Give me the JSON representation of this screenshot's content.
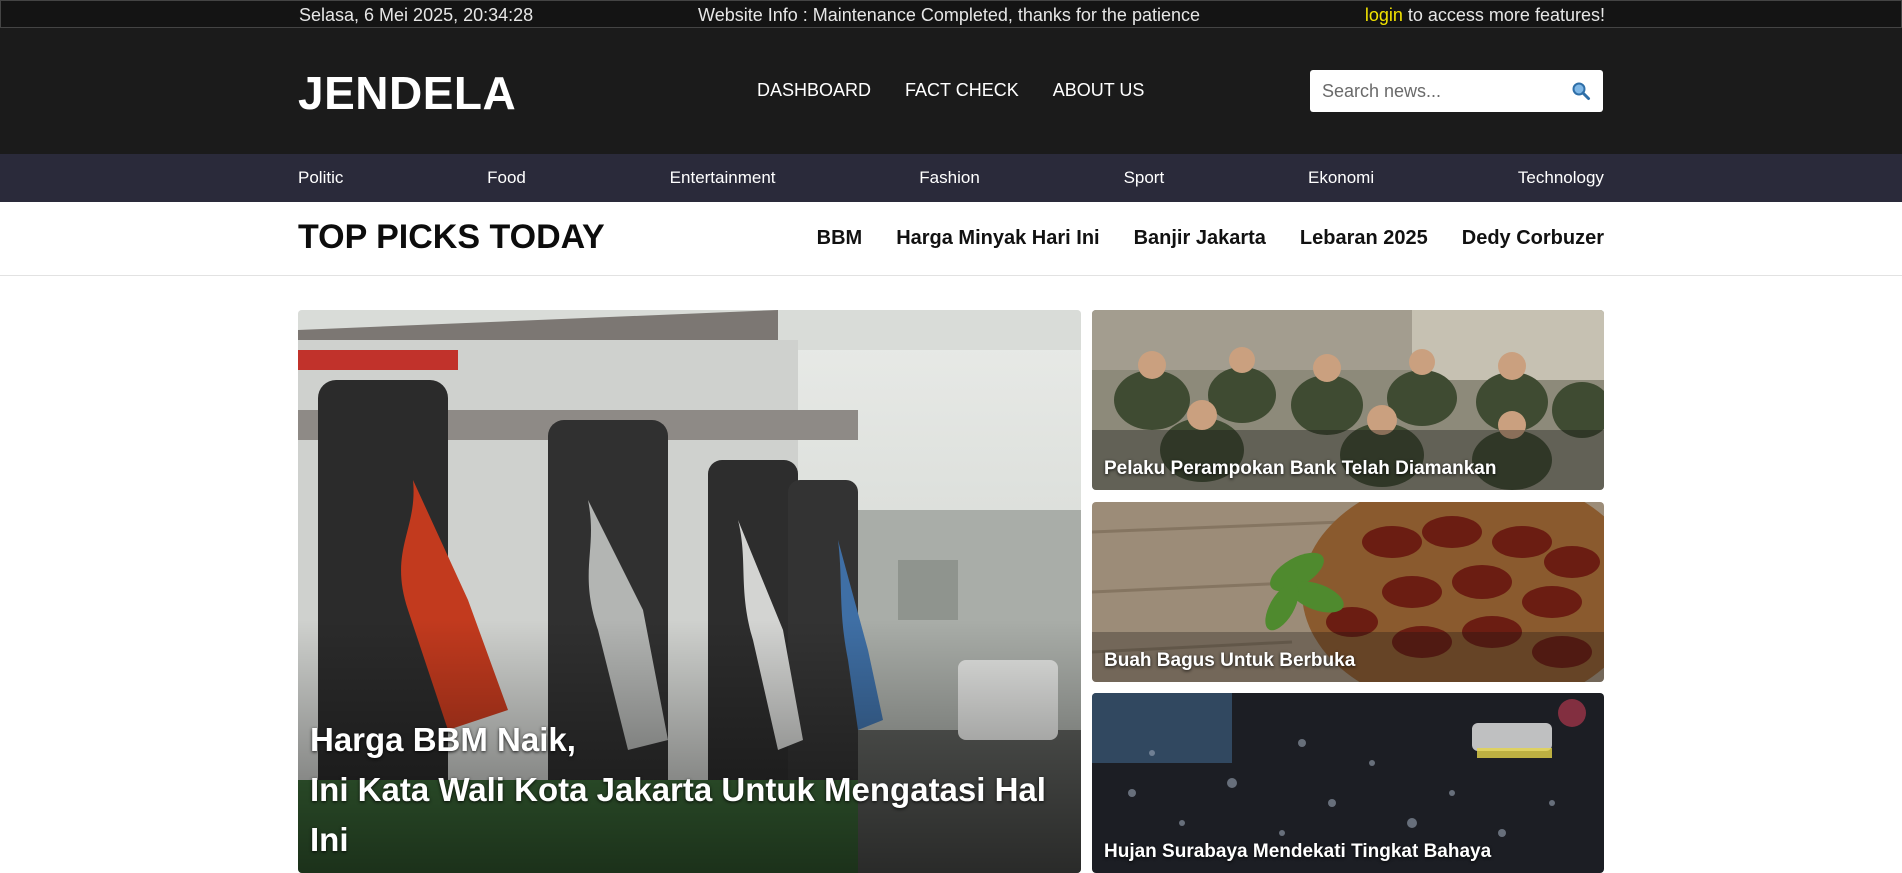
{
  "topbar": {
    "datetime": "Selasa, 6 Mei 2025, 20:34:28",
    "info": "Website Info : Maintenance Completed, thanks for the patience",
    "login_link": "login",
    "login_suffix": " to access more features!"
  },
  "header": {
    "logo": "JENDELA",
    "nav": [
      "DASHBOARD",
      "FACT CHECK",
      "ABOUT US"
    ],
    "search_placeholder": "Search news...",
    "search_icon": "magnifier-icon"
  },
  "categories": [
    "Politic",
    "Food",
    "Entertainment",
    "Fashion",
    "Sport",
    "Ekonomi",
    "Technology"
  ],
  "top_picks": {
    "title": "TOP PICKS TODAY",
    "tags": [
      "BBM",
      "Harga Minyak Hari Ini",
      "Banjir Jakarta",
      "Lebaran 2025",
      "Dedy Corbuzer"
    ]
  },
  "articles": {
    "main": {
      "line1": "Harga BBM Naik,",
      "line2": "Ini Kata Wali Kota Jakarta Untuk Mengatasi Hal Ini",
      "image": "fuel-pump-photo"
    },
    "side": [
      {
        "title": "Pelaku Perampokan Bank Telah Diamankan",
        "image": "military-meeting-photo"
      },
      {
        "title": "Buah Bagus Untuk Berbuka",
        "image": "dates-fruit-photo"
      },
      {
        "title": "Hujan Surabaya Mendekati Tingkat Bahaya",
        "image": "rainy-window-photo"
      }
    ]
  },
  "colors": {
    "topbar_bg": "#141414",
    "header_bg": "#1b1b1b",
    "category_bg": "#2a2a3a",
    "login_accent": "#f1e200"
  }
}
